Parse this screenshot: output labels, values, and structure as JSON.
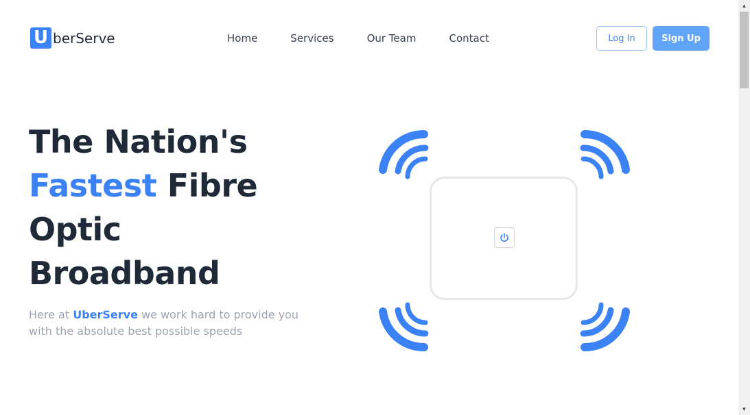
{
  "brand": {
    "mark": "U",
    "name": "berServe"
  },
  "nav": {
    "items": [
      {
        "label": "Home"
      },
      {
        "label": "Services"
      },
      {
        "label": "Our Team"
      },
      {
        "label": "Contact"
      }
    ]
  },
  "auth": {
    "login_label": "Log In",
    "signup_label": "Sign Up"
  },
  "hero": {
    "title_line1": "The Nation's",
    "title_accent": "Fastest",
    "title_line2_rest": " Fibre",
    "title_line3": "Optic",
    "title_line4": "Broadband",
    "subtitle_before": "Here at ",
    "subtitle_brand": "UberServe",
    "subtitle_after": " we work hard to provide you with the absolute best possible speeds"
  },
  "illustration": {
    "router_icon": "power-icon",
    "wave_icon": "wifi-wave-icon",
    "accent_color": "#3b82f6"
  },
  "colors": {
    "accent": "#3b82f6",
    "heading": "#1f2937",
    "muted": "#9ca3af"
  },
  "scrollbar": {
    "up_glyph": "▲",
    "down_glyph": "▼"
  }
}
